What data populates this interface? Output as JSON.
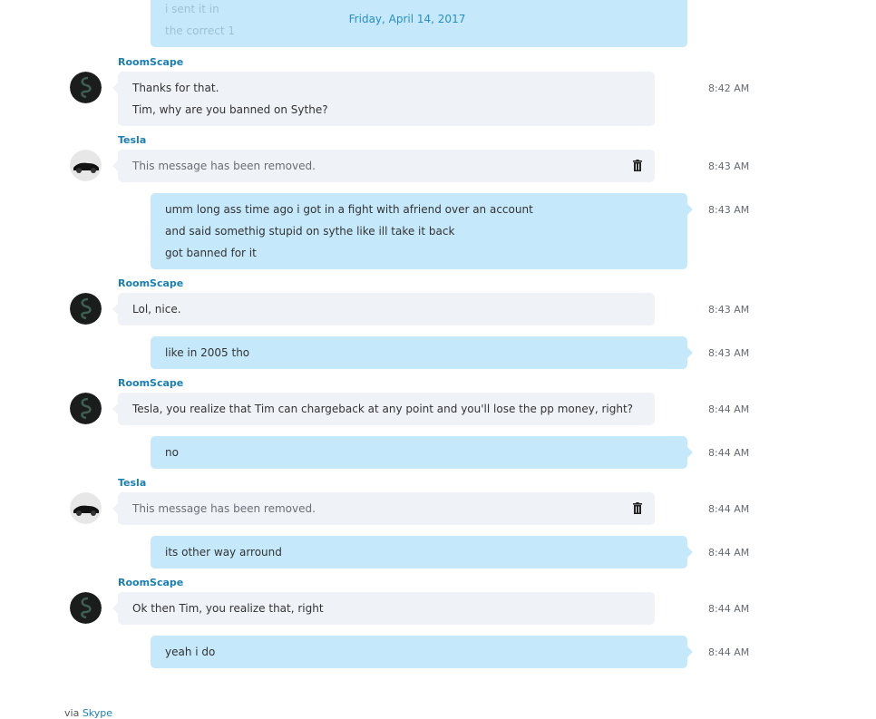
{
  "previous_message": {
    "lines": [
      "i sent it in",
      "the correct 1"
    ]
  },
  "date_divider": "Friday, April 14, 2017",
  "messages": [
    {
      "sender": "RoomScape",
      "lines": [
        "Thanks for that.",
        "Tim, why are you banned on Sythe?"
      ],
      "time": "8:42 AM"
    },
    {
      "sender": "Tesla",
      "lines": [
        "This message has been removed."
      ],
      "time": "8:43 AM"
    },
    {
      "lines": [
        "umm long ass time ago i got in a fight with afriend over an account",
        "and said somethig stupid on sythe like ill take it back",
        "got banned for it"
      ],
      "time": "8:43 AM"
    },
    {
      "sender": "RoomScape",
      "lines": [
        "Lol, nice."
      ],
      "time": "8:43 AM"
    },
    {
      "lines": [
        "like in 2005 tho"
      ],
      "time": "8:43 AM"
    },
    {
      "sender": "RoomScape",
      "lines": [
        "Tesla, you realize that Tim can chargeback at any point and you'll lose the pp money, right?"
      ],
      "time": "8:44 AM"
    },
    {
      "lines": [
        "no"
      ],
      "time": "8:44 AM"
    },
    {
      "sender": "Tesla",
      "lines": [
        "This message has been removed."
      ],
      "time": "8:44 AM"
    },
    {
      "lines": [
        "its other way arround"
      ],
      "time": "8:44 AM"
    },
    {
      "sender": "RoomScape",
      "lines": [
        "Ok then Tim, you realize that, right"
      ],
      "time": "8:44 AM"
    },
    {
      "lines": [
        "yeah i do"
      ],
      "time": "8:44 AM"
    }
  ],
  "footer": {
    "prefix": "via",
    "link": "Skype"
  },
  "colors": {
    "outgoing_bubble": "#c5e9fb",
    "incoming_bubble": "#eff2f6",
    "sender_name": "#1a7fb0",
    "date_divider": "#2a8fc0"
  },
  "icons": {
    "delete": "trash-icon"
  }
}
